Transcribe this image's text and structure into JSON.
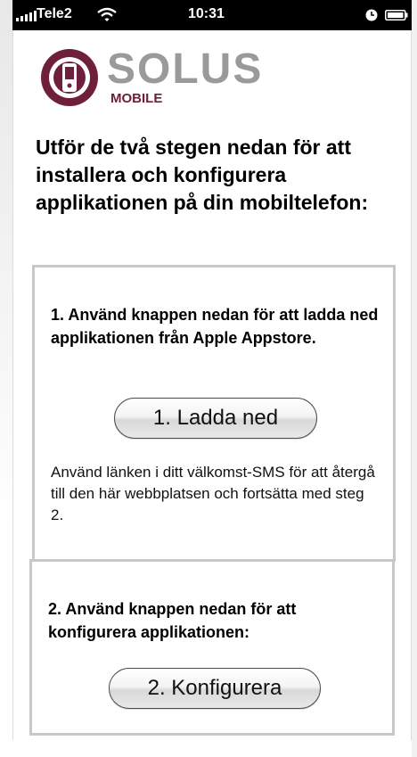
{
  "status_bar": {
    "carrier": "Tele2",
    "time": "10:31",
    "icons": [
      "signal-icon",
      "wifi-icon",
      "clock-icon",
      "battery-icon"
    ]
  },
  "logo": {
    "word": "SOLUS",
    "sub": "MOBILE",
    "colors": {
      "brand": "#6d1f3c",
      "word": "#9a9a9a"
    }
  },
  "intro": "Utför de två stegen nedan för att installera och konfigurera applikationen på din mobiltelefon:",
  "step1": {
    "title": "1. Använd knappen nedan för att ladda ned applikationen från Apple Appstore.",
    "button_label": "1. Ladda ned",
    "note": "Använd länken i ditt välkomst-SMS för att återgå till den här webbplatsen och fortsätta med steg 2."
  },
  "step2": {
    "title": "2. Använd knappen nedan för att konfigurera applikationen:",
    "button_label": "2. Konfigurera"
  }
}
